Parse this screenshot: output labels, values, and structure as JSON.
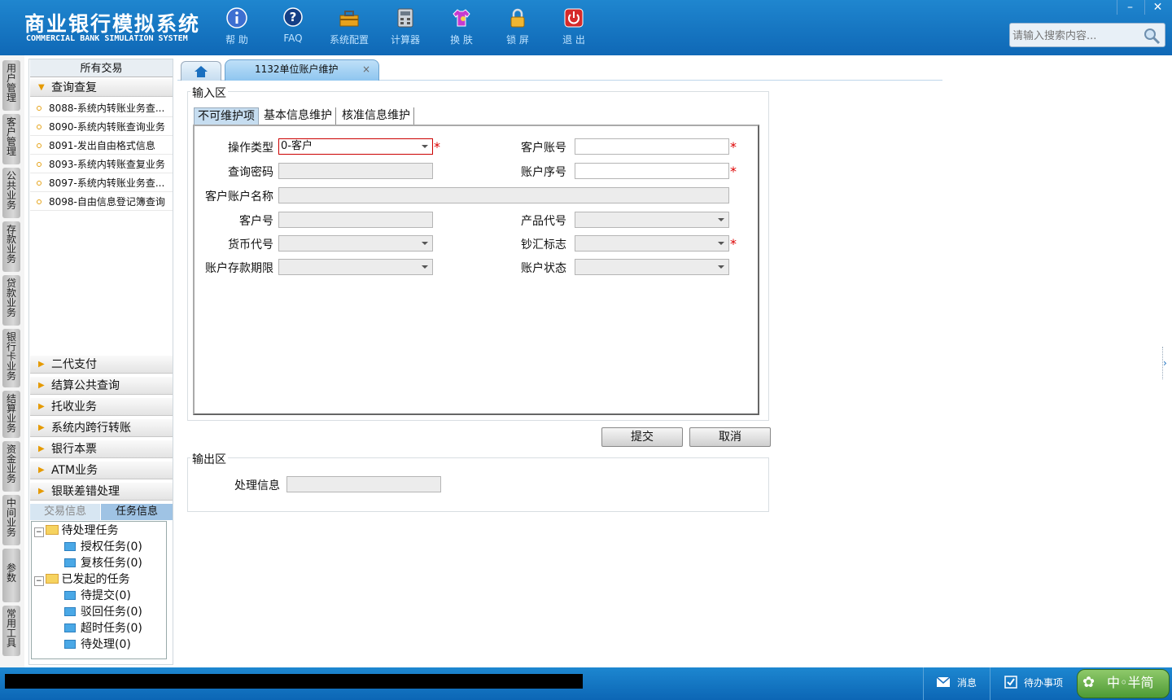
{
  "header": {
    "title": "商业银行模拟系统",
    "subtitle": "COMMERCIAL BANK SIMULATION SYSTEM",
    "toolbar": [
      {
        "label": "帮 助",
        "icon": "info-icon"
      },
      {
        "label": "FAQ",
        "icon": "help-icon"
      },
      {
        "label": "系统配置",
        "icon": "toolbox-icon"
      },
      {
        "label": "计算器",
        "icon": "calculator-icon"
      },
      {
        "label": "换 肤",
        "icon": "shirt-icon"
      },
      {
        "label": "锁 屏",
        "icon": "lock-icon"
      },
      {
        "label": "退 出",
        "icon": "power-icon"
      }
    ],
    "search_placeholder": "请输入搜索内容..."
  },
  "window": {
    "minimize": "–",
    "close": "✕"
  },
  "vertical_tabs": [
    "用户管理",
    "客户管理",
    "公共业务",
    "存款业务",
    "贷款业务",
    "银行卡业务",
    "结算业务",
    "资金业务",
    "中间业务",
    "参数",
    "常用工具"
  ],
  "sidebar": {
    "title": "所有交易",
    "open_group": "查询查复",
    "items": [
      "8088-系统内转账业务查...",
      "8090-系统内转账查询业务",
      "8091-发出自由格式信息",
      "8093-系统内转账查复业务",
      "8097-系统内转账业务查...",
      "8098-自由信息登记簿查询"
    ],
    "groups": [
      "二代支付",
      "结算公共查询",
      "托收业务",
      "系统内跨行转账",
      "银行本票",
      "ATM业务",
      "银联差错处理"
    ],
    "bottom_tabs": [
      "交易信息",
      "任务信息"
    ],
    "tree": {
      "pending": "待处理任务",
      "auth": "授权任务(0)",
      "review": "复核任务(0)",
      "initiated": "已发起的任务",
      "to_submit": "待提交(0)",
      "rejected": "驳回任务(0)",
      "timeout": "超时任务(0)",
      "to_process": "待处理(0)"
    }
  },
  "tab": {
    "label": "1132单位账户维护",
    "close": "×"
  },
  "input_area": {
    "legend": "输入区",
    "subtabs": [
      "不可维护项",
      "基本信息维护",
      "核准信息维护"
    ],
    "labels": {
      "op_type": "操作类型",
      "cust_account": "客户账号",
      "query_pwd": "查询密码",
      "acct_seq": "账户序号",
      "acct_name": "客户账户名称",
      "cust_no": "客户号",
      "product_code": "产品代号",
      "currency": "货币代号",
      "cash_flag": "钞汇标志",
      "term": "账户存款期限",
      "status": "账户状态"
    },
    "values": {
      "op_type": "0-客户"
    },
    "required": "*"
  },
  "buttons": {
    "submit": "提交",
    "cancel": "取消"
  },
  "output_area": {
    "legend": "输出区",
    "process_info": "处理信息"
  },
  "statusbar": {
    "message": "消息",
    "todo": "待办事项",
    "ime": "中◦半简"
  },
  "colors": {
    "header_blue": "#1a7cc6",
    "required_red": "#dd0000",
    "accent_orange": "#e59a00"
  }
}
